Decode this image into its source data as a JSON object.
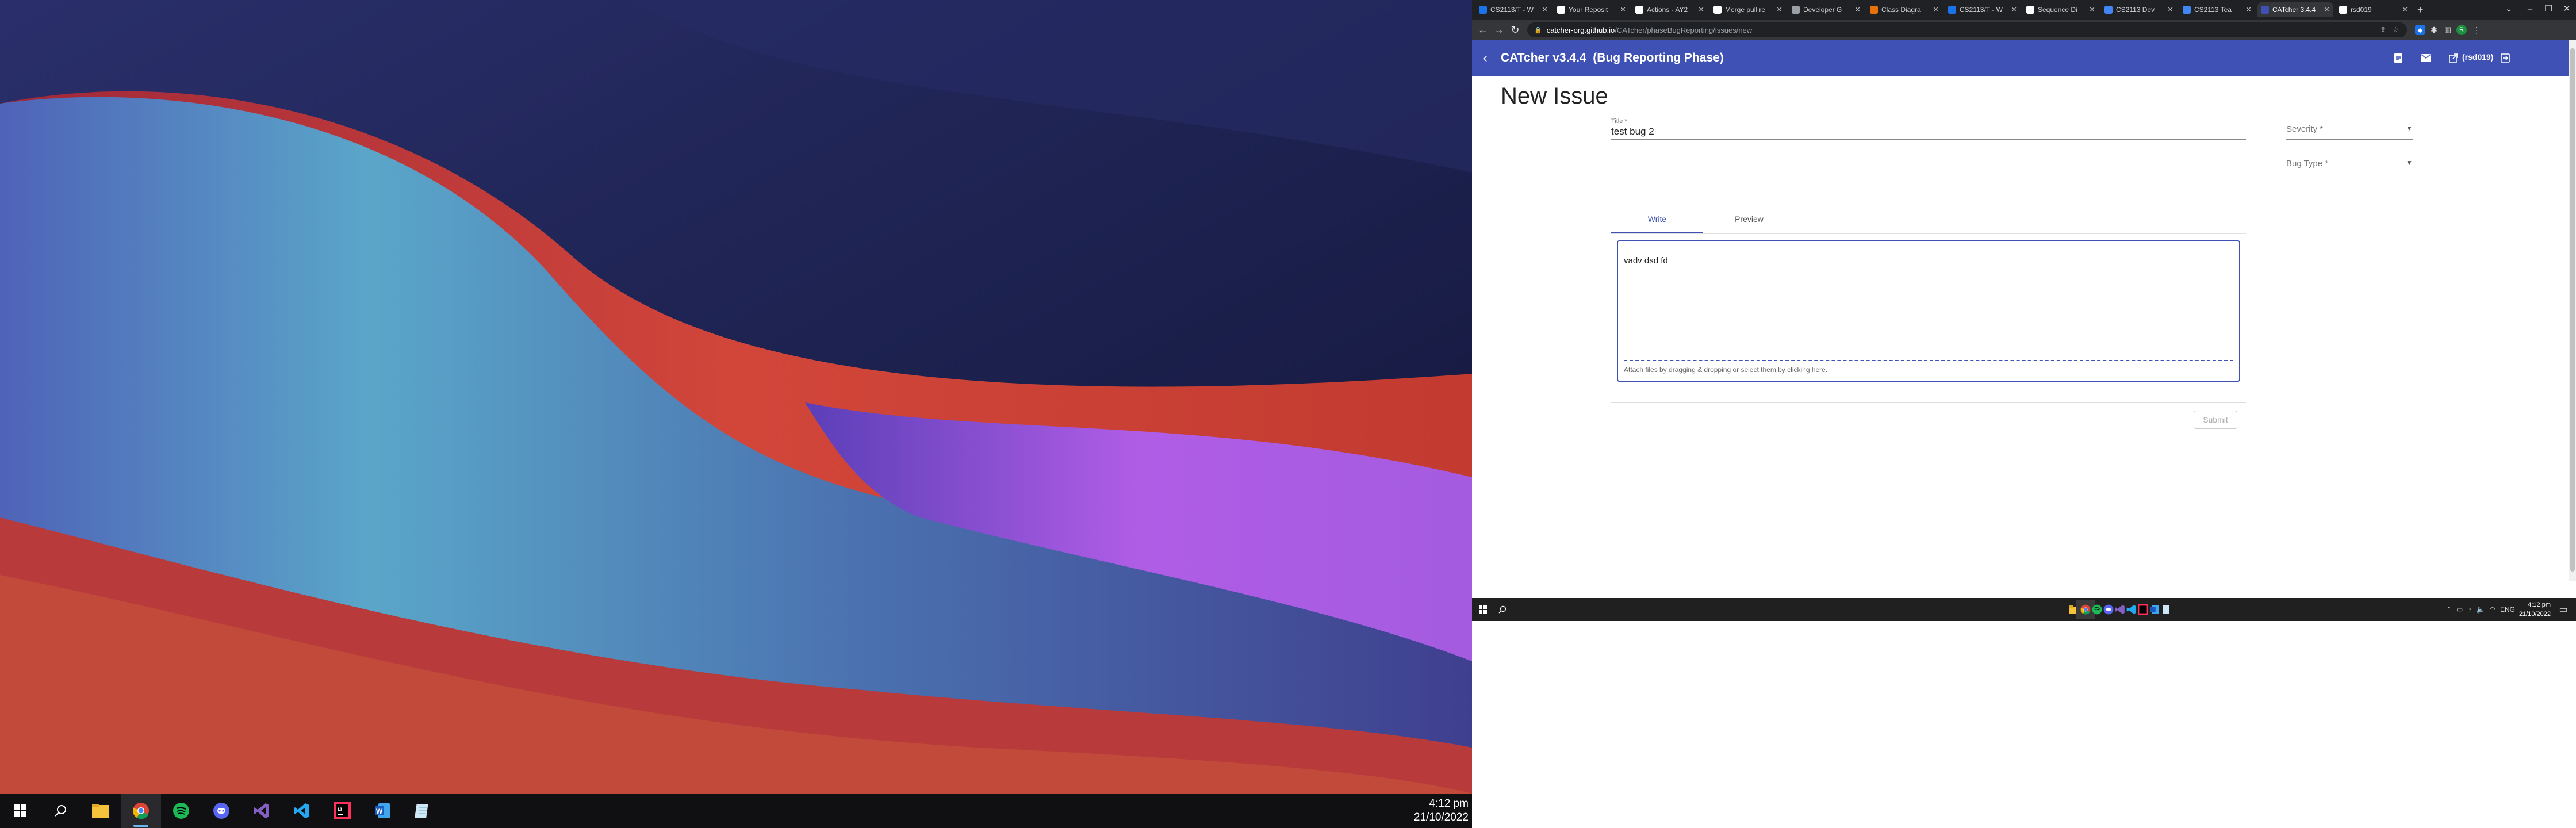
{
  "left_taskbar": {
    "apps": [
      {
        "icon": "windows-start-icon"
      },
      {
        "icon": "search-icon"
      },
      {
        "icon": "file-explorer-icon"
      },
      {
        "icon": "chrome-icon",
        "active": true
      },
      {
        "icon": "spotify-icon"
      },
      {
        "icon": "discord-icon"
      },
      {
        "icon": "visual-studio-icon"
      },
      {
        "icon": "vscode-icon"
      },
      {
        "icon": "intellij-icon"
      },
      {
        "icon": "word-icon"
      },
      {
        "icon": "notepad-icon"
      }
    ],
    "time": "4:12 pm",
    "date": "21/10/2022"
  },
  "browser": {
    "tabs": [
      {
        "title": "CS2113/T - W",
        "color": "#1a73e8"
      },
      {
        "title": "Your Reposit",
        "color": "#ffffff"
      },
      {
        "title": "Actions · AY2",
        "color": "#ffffff"
      },
      {
        "title": "Merge pull re",
        "color": "#ffffff"
      },
      {
        "title": "Developer G",
        "color": "#9aa0a6"
      },
      {
        "title": "Class Diagra",
        "color": "#e8710a"
      },
      {
        "title": "CS2113/T - W",
        "color": "#1a73e8"
      },
      {
        "title": "Sequence Di",
        "color": "#ffffff"
      },
      {
        "title": "CS2113 Dev",
        "color": "#4285f4"
      },
      {
        "title": "CS2113 Tea",
        "color": "#4285f4"
      },
      {
        "title": "CATcher 3.4.4",
        "color": "#3f51b5",
        "active": true
      },
      {
        "title": "rsd019",
        "color": "#ffffff"
      }
    ],
    "new_tab_label": "+",
    "url_domain": "catcher-org.github.io",
    "url_path": "/CATcher/phaseBugReporting/issues/new"
  },
  "app": {
    "title": "CATcher v3.4.4  (Bug Reporting Phase)",
    "user": "(rsd019)",
    "page_title": "New Issue",
    "title_field": {
      "label": "Title *",
      "value": "test bug 2"
    },
    "severity": {
      "label": "Severity *"
    },
    "bug_type": {
      "label": "Bug Type *"
    },
    "tabs": {
      "write": "Write",
      "preview": "Preview"
    },
    "description_text": "vadv dsd fd",
    "attach_hint": "Attach files by dragging & dropping or select them by clicking here.",
    "submit_label": "Submit"
  },
  "right_taskbar": {
    "time": "4:12 pm",
    "date": "21/10/2022",
    "lang": "ENG"
  },
  "colors": {
    "primary": "#3f51b5",
    "tabstrip": "#202124",
    "toolbar_bg": "#35363a"
  }
}
